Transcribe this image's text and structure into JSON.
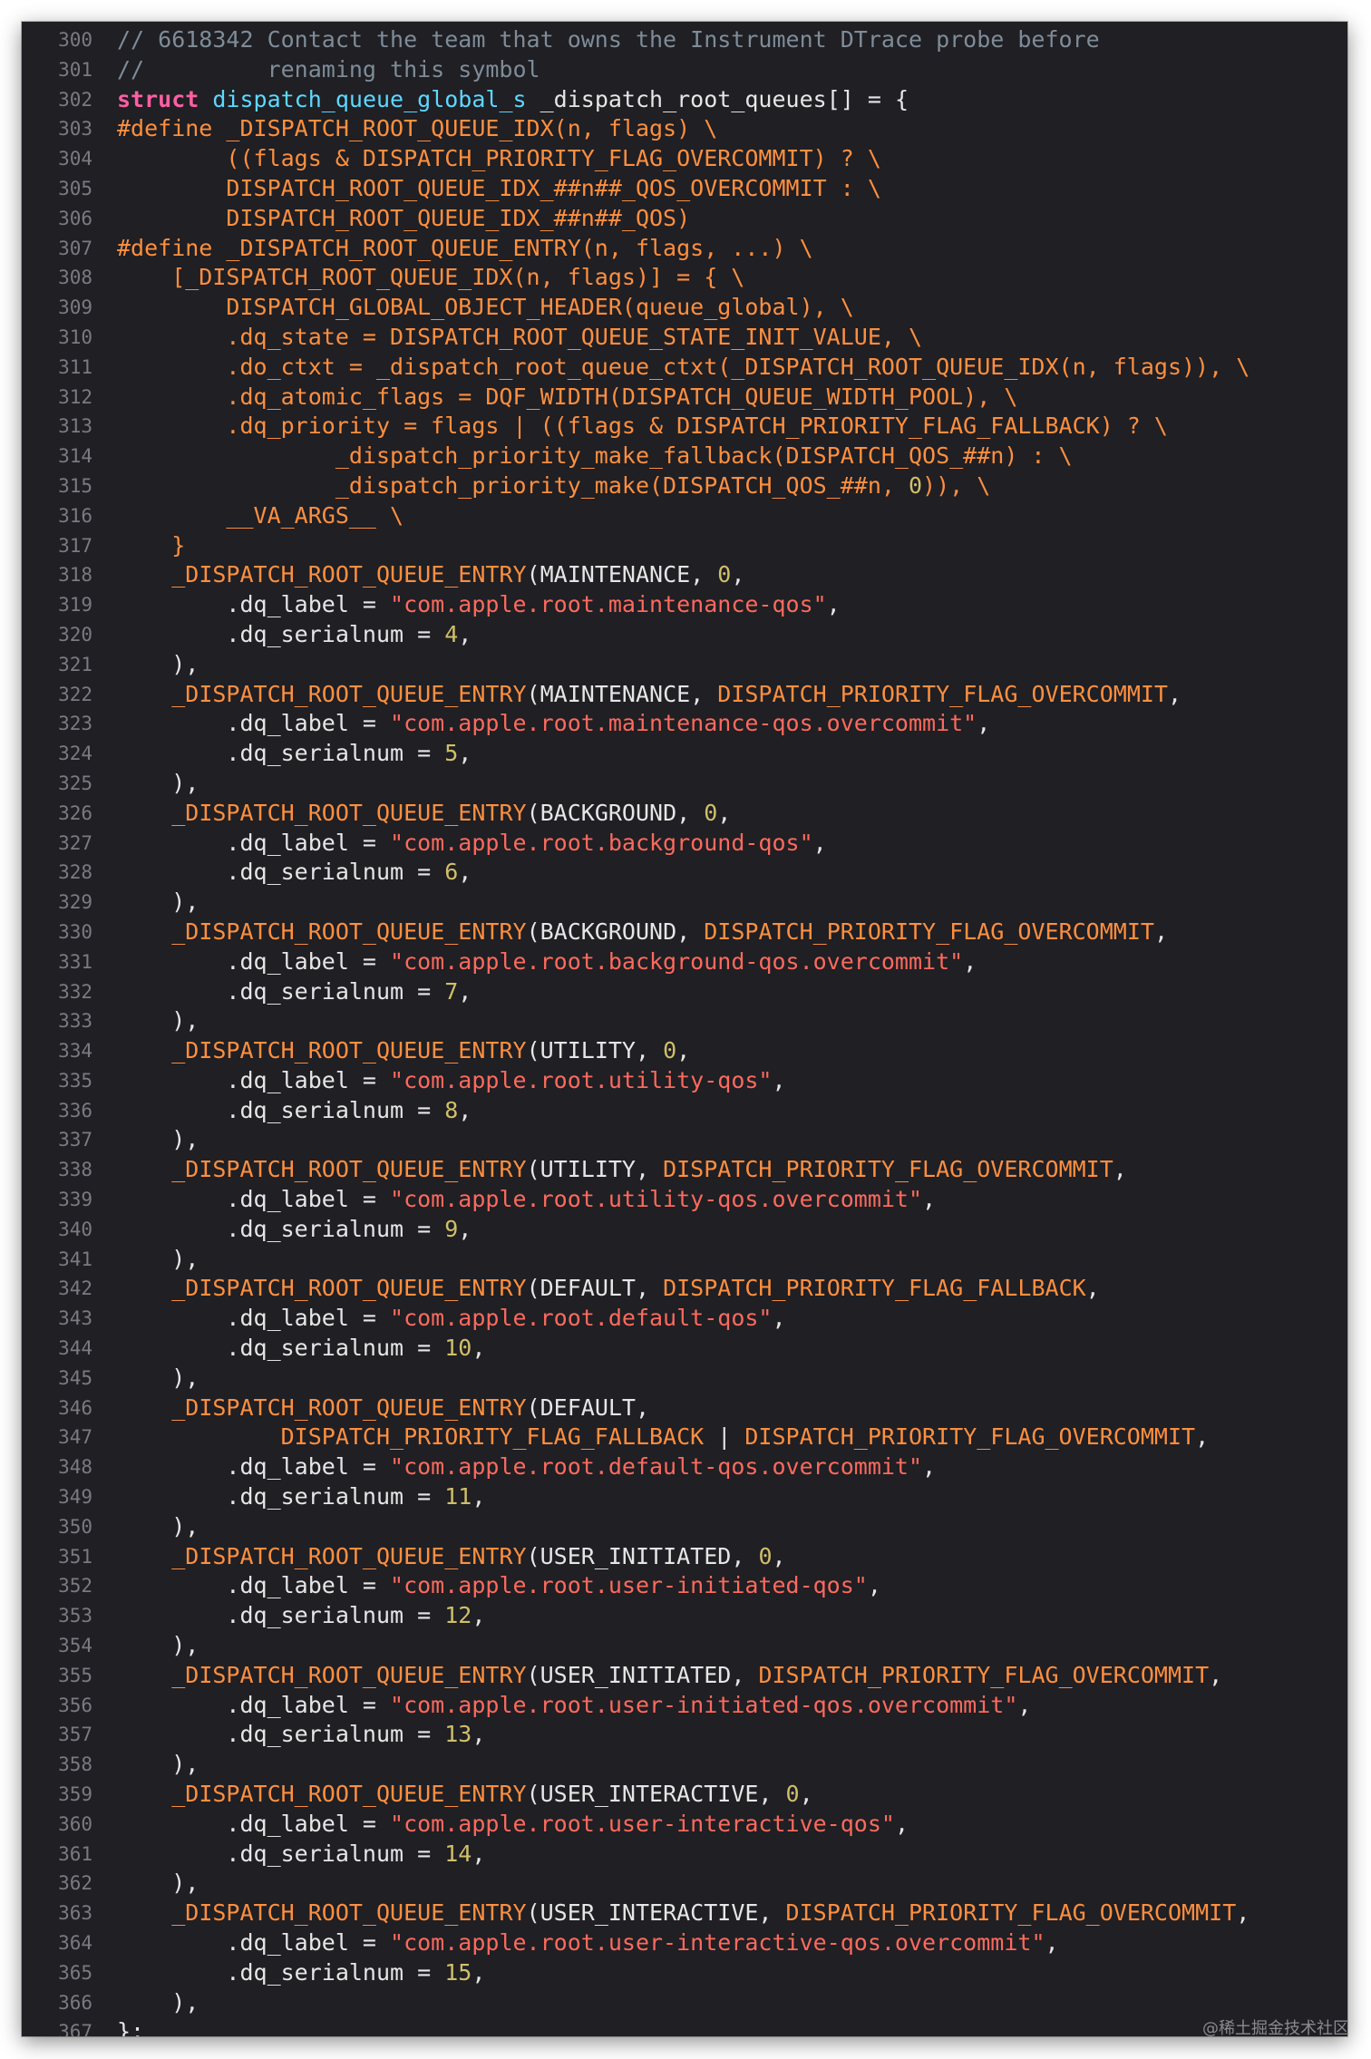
{
  "colors": {
    "background": "#1f1f24",
    "line_number": "#7a7a80",
    "plain": "#e6e6e6",
    "comment": "#7f8c98",
    "keyword": "#fc5fa3",
    "type": "#5dd8ff",
    "macro": "#fd8f3f",
    "string": "#fc6a5d",
    "number": "#d0bf69"
  },
  "editor": {
    "lines": [
      {
        "n": "300",
        "tokens": [
          [
            "comment",
            "// 6618342 Contact the team that owns the Instrument DTrace probe before"
          ]
        ]
      },
      {
        "n": "301",
        "tokens": [
          [
            "comment",
            "//         renaming this symbol"
          ]
        ]
      },
      {
        "n": "302",
        "tokens": [
          [
            "keyword",
            "struct"
          ],
          [
            "plain",
            " "
          ],
          [
            "type",
            "dispatch_queue_global_s"
          ],
          [
            "plain",
            " _dispatch_root_queues[] = {"
          ]
        ]
      },
      {
        "n": "303",
        "tokens": [
          [
            "macro",
            "#define _DISPATCH_ROOT_QUEUE_IDX(n, flags) \\"
          ]
        ]
      },
      {
        "n": "304",
        "tokens": [
          [
            "macro",
            "        ((flags & DISPATCH_PRIORITY_FLAG_OVERCOMMIT) ? \\"
          ]
        ]
      },
      {
        "n": "305",
        "tokens": [
          [
            "macro",
            "        DISPATCH_ROOT_QUEUE_IDX_##n##_QOS_OVERCOMMIT : \\"
          ]
        ]
      },
      {
        "n": "306",
        "tokens": [
          [
            "macro",
            "        DISPATCH_ROOT_QUEUE_IDX_##n##_QOS)"
          ]
        ]
      },
      {
        "n": "307",
        "tokens": [
          [
            "macro",
            "#define _DISPATCH_ROOT_QUEUE_ENTRY(n, flags, ...) \\"
          ]
        ]
      },
      {
        "n": "308",
        "tokens": [
          [
            "macro",
            "    [_DISPATCH_ROOT_QUEUE_IDX(n, flags)] = { \\"
          ]
        ]
      },
      {
        "n": "309",
        "tokens": [
          [
            "macro",
            "        DISPATCH_GLOBAL_OBJECT_HEADER(queue_global), \\"
          ]
        ]
      },
      {
        "n": "310",
        "tokens": [
          [
            "macro",
            "        .dq_state = DISPATCH_ROOT_QUEUE_STATE_INIT_VALUE, \\"
          ]
        ]
      },
      {
        "n": "311",
        "tokens": [
          [
            "macro",
            "        .do_ctxt = _dispatch_root_queue_ctxt(_DISPATCH_ROOT_QUEUE_IDX(n, flags)), \\"
          ]
        ]
      },
      {
        "n": "312",
        "tokens": [
          [
            "macro",
            "        .dq_atomic_flags = DQF_WIDTH(DISPATCH_QUEUE_WIDTH_POOL), \\"
          ]
        ]
      },
      {
        "n": "313",
        "tokens": [
          [
            "macro",
            "        .dq_priority = flags | ((flags & DISPATCH_PRIORITY_FLAG_FALLBACK) ? \\"
          ]
        ]
      },
      {
        "n": "314",
        "tokens": [
          [
            "macro",
            "                _dispatch_priority_make_fallback(DISPATCH_QOS_##n) : \\"
          ]
        ]
      },
      {
        "n": "315",
        "tokens": [
          [
            "macro",
            "                _dispatch_priority_make(DISPATCH_QOS_##n, "
          ],
          [
            "number",
            "0"
          ],
          [
            "macro",
            ")), \\"
          ]
        ]
      },
      {
        "n": "316",
        "tokens": [
          [
            "macro",
            "        __VA_ARGS__ \\"
          ]
        ]
      },
      {
        "n": "317",
        "tokens": [
          [
            "macro",
            "    }"
          ]
        ]
      },
      {
        "n": "318",
        "tokens": [
          [
            "plain",
            "    "
          ],
          [
            "macro",
            "_DISPATCH_ROOT_QUEUE_ENTRY"
          ],
          [
            "plain",
            "(MAINTENANCE, "
          ],
          [
            "number",
            "0"
          ],
          [
            "plain",
            ","
          ]
        ]
      },
      {
        "n": "319",
        "tokens": [
          [
            "plain",
            "        .dq_label = "
          ],
          [
            "string",
            "\"com.apple.root.maintenance-qos\""
          ],
          [
            "plain",
            ","
          ]
        ]
      },
      {
        "n": "320",
        "tokens": [
          [
            "plain",
            "        .dq_serialnum = "
          ],
          [
            "number",
            "4"
          ],
          [
            "plain",
            ","
          ]
        ]
      },
      {
        "n": "321",
        "tokens": [
          [
            "plain",
            "    ),"
          ]
        ]
      },
      {
        "n": "322",
        "tokens": [
          [
            "plain",
            "    "
          ],
          [
            "macro",
            "_DISPATCH_ROOT_QUEUE_ENTRY"
          ],
          [
            "plain",
            "(MAINTENANCE, "
          ],
          [
            "macro",
            "DISPATCH_PRIORITY_FLAG_OVERCOMMIT"
          ],
          [
            "plain",
            ","
          ]
        ]
      },
      {
        "n": "323",
        "tokens": [
          [
            "plain",
            "        .dq_label = "
          ],
          [
            "string",
            "\"com.apple.root.maintenance-qos.overcommit\""
          ],
          [
            "plain",
            ","
          ]
        ]
      },
      {
        "n": "324",
        "tokens": [
          [
            "plain",
            "        .dq_serialnum = "
          ],
          [
            "number",
            "5"
          ],
          [
            "plain",
            ","
          ]
        ]
      },
      {
        "n": "325",
        "tokens": [
          [
            "plain",
            "    ),"
          ]
        ]
      },
      {
        "n": "326",
        "tokens": [
          [
            "plain",
            "    "
          ],
          [
            "macro",
            "_DISPATCH_ROOT_QUEUE_ENTRY"
          ],
          [
            "plain",
            "(BACKGROUND, "
          ],
          [
            "number",
            "0"
          ],
          [
            "plain",
            ","
          ]
        ]
      },
      {
        "n": "327",
        "tokens": [
          [
            "plain",
            "        .dq_label = "
          ],
          [
            "string",
            "\"com.apple.root.background-qos\""
          ],
          [
            "plain",
            ","
          ]
        ]
      },
      {
        "n": "328",
        "tokens": [
          [
            "plain",
            "        .dq_serialnum = "
          ],
          [
            "number",
            "6"
          ],
          [
            "plain",
            ","
          ]
        ]
      },
      {
        "n": "329",
        "tokens": [
          [
            "plain",
            "    ),"
          ]
        ]
      },
      {
        "n": "330",
        "tokens": [
          [
            "plain",
            "    "
          ],
          [
            "macro",
            "_DISPATCH_ROOT_QUEUE_ENTRY"
          ],
          [
            "plain",
            "(BACKGROUND, "
          ],
          [
            "macro",
            "DISPATCH_PRIORITY_FLAG_OVERCOMMIT"
          ],
          [
            "plain",
            ","
          ]
        ]
      },
      {
        "n": "331",
        "tokens": [
          [
            "plain",
            "        .dq_label = "
          ],
          [
            "string",
            "\"com.apple.root.background-qos.overcommit\""
          ],
          [
            "plain",
            ","
          ]
        ]
      },
      {
        "n": "332",
        "tokens": [
          [
            "plain",
            "        .dq_serialnum = "
          ],
          [
            "number",
            "7"
          ],
          [
            "plain",
            ","
          ]
        ]
      },
      {
        "n": "333",
        "tokens": [
          [
            "plain",
            "    ),"
          ]
        ]
      },
      {
        "n": "334",
        "tokens": [
          [
            "plain",
            "    "
          ],
          [
            "macro",
            "_DISPATCH_ROOT_QUEUE_ENTRY"
          ],
          [
            "plain",
            "(UTILITY, "
          ],
          [
            "number",
            "0"
          ],
          [
            "plain",
            ","
          ]
        ]
      },
      {
        "n": "335",
        "tokens": [
          [
            "plain",
            "        .dq_label = "
          ],
          [
            "string",
            "\"com.apple.root.utility-qos\""
          ],
          [
            "plain",
            ","
          ]
        ]
      },
      {
        "n": "336",
        "tokens": [
          [
            "plain",
            "        .dq_serialnum = "
          ],
          [
            "number",
            "8"
          ],
          [
            "plain",
            ","
          ]
        ]
      },
      {
        "n": "337",
        "tokens": [
          [
            "plain",
            "    ),"
          ]
        ]
      },
      {
        "n": "338",
        "tokens": [
          [
            "plain",
            "    "
          ],
          [
            "macro",
            "_DISPATCH_ROOT_QUEUE_ENTRY"
          ],
          [
            "plain",
            "(UTILITY, "
          ],
          [
            "macro",
            "DISPATCH_PRIORITY_FLAG_OVERCOMMIT"
          ],
          [
            "plain",
            ","
          ]
        ]
      },
      {
        "n": "339",
        "tokens": [
          [
            "plain",
            "        .dq_label = "
          ],
          [
            "string",
            "\"com.apple.root.utility-qos.overcommit\""
          ],
          [
            "plain",
            ","
          ]
        ]
      },
      {
        "n": "340",
        "tokens": [
          [
            "plain",
            "        .dq_serialnum = "
          ],
          [
            "number",
            "9"
          ],
          [
            "plain",
            ","
          ]
        ]
      },
      {
        "n": "341",
        "tokens": [
          [
            "plain",
            "    ),"
          ]
        ]
      },
      {
        "n": "342",
        "tokens": [
          [
            "plain",
            "    "
          ],
          [
            "macro",
            "_DISPATCH_ROOT_QUEUE_ENTRY"
          ],
          [
            "plain",
            "(DEFAULT, "
          ],
          [
            "macro",
            "DISPATCH_PRIORITY_FLAG_FALLBACK"
          ],
          [
            "plain",
            ","
          ]
        ]
      },
      {
        "n": "343",
        "tokens": [
          [
            "plain",
            "        .dq_label = "
          ],
          [
            "string",
            "\"com.apple.root.default-qos\""
          ],
          [
            "plain",
            ","
          ]
        ]
      },
      {
        "n": "344",
        "tokens": [
          [
            "plain",
            "        .dq_serialnum = "
          ],
          [
            "number",
            "10"
          ],
          [
            "plain",
            ","
          ]
        ]
      },
      {
        "n": "345",
        "tokens": [
          [
            "plain",
            "    ),"
          ]
        ]
      },
      {
        "n": "346",
        "tokens": [
          [
            "plain",
            "    "
          ],
          [
            "macro",
            "_DISPATCH_ROOT_QUEUE_ENTRY"
          ],
          [
            "plain",
            "(DEFAULT,"
          ]
        ]
      },
      {
        "n": "347",
        "tokens": [
          [
            "plain",
            "            "
          ],
          [
            "macro",
            "DISPATCH_PRIORITY_FLAG_FALLBACK"
          ],
          [
            "plain",
            " | "
          ],
          [
            "macro",
            "DISPATCH_PRIORITY_FLAG_OVERCOMMIT"
          ],
          [
            "plain",
            ","
          ]
        ]
      },
      {
        "n": "348",
        "tokens": [
          [
            "plain",
            "        .dq_label = "
          ],
          [
            "string",
            "\"com.apple.root.default-qos.overcommit\""
          ],
          [
            "plain",
            ","
          ]
        ]
      },
      {
        "n": "349",
        "tokens": [
          [
            "plain",
            "        .dq_serialnum = "
          ],
          [
            "number",
            "11"
          ],
          [
            "plain",
            ","
          ]
        ]
      },
      {
        "n": "350",
        "tokens": [
          [
            "plain",
            "    ),"
          ]
        ]
      },
      {
        "n": "351",
        "tokens": [
          [
            "plain",
            "    "
          ],
          [
            "macro",
            "_DISPATCH_ROOT_QUEUE_ENTRY"
          ],
          [
            "plain",
            "(USER_INITIATED, "
          ],
          [
            "number",
            "0"
          ],
          [
            "plain",
            ","
          ]
        ]
      },
      {
        "n": "352",
        "tokens": [
          [
            "plain",
            "        .dq_label = "
          ],
          [
            "string",
            "\"com.apple.root.user-initiated-qos\""
          ],
          [
            "plain",
            ","
          ]
        ]
      },
      {
        "n": "353",
        "tokens": [
          [
            "plain",
            "        .dq_serialnum = "
          ],
          [
            "number",
            "12"
          ],
          [
            "plain",
            ","
          ]
        ]
      },
      {
        "n": "354",
        "tokens": [
          [
            "plain",
            "    ),"
          ]
        ]
      },
      {
        "n": "355",
        "tokens": [
          [
            "plain",
            "    "
          ],
          [
            "macro",
            "_DISPATCH_ROOT_QUEUE_ENTRY"
          ],
          [
            "plain",
            "(USER_INITIATED, "
          ],
          [
            "macro",
            "DISPATCH_PRIORITY_FLAG_OVERCOMMIT"
          ],
          [
            "plain",
            ","
          ]
        ]
      },
      {
        "n": "356",
        "tokens": [
          [
            "plain",
            "        .dq_label = "
          ],
          [
            "string",
            "\"com.apple.root.user-initiated-qos.overcommit\""
          ],
          [
            "plain",
            ","
          ]
        ]
      },
      {
        "n": "357",
        "tokens": [
          [
            "plain",
            "        .dq_serialnum = "
          ],
          [
            "number",
            "13"
          ],
          [
            "plain",
            ","
          ]
        ]
      },
      {
        "n": "358",
        "tokens": [
          [
            "plain",
            "    ),"
          ]
        ]
      },
      {
        "n": "359",
        "tokens": [
          [
            "plain",
            "    "
          ],
          [
            "macro",
            "_DISPATCH_ROOT_QUEUE_ENTRY"
          ],
          [
            "plain",
            "(USER_INTERACTIVE, "
          ],
          [
            "number",
            "0"
          ],
          [
            "plain",
            ","
          ]
        ]
      },
      {
        "n": "360",
        "tokens": [
          [
            "plain",
            "        .dq_label = "
          ],
          [
            "string",
            "\"com.apple.root.user-interactive-qos\""
          ],
          [
            "plain",
            ","
          ]
        ]
      },
      {
        "n": "361",
        "tokens": [
          [
            "plain",
            "        .dq_serialnum = "
          ],
          [
            "number",
            "14"
          ],
          [
            "plain",
            ","
          ]
        ]
      },
      {
        "n": "362",
        "tokens": [
          [
            "plain",
            "    ),"
          ]
        ]
      },
      {
        "n": "363",
        "tokens": [
          [
            "plain",
            "    "
          ],
          [
            "macro",
            "_DISPATCH_ROOT_QUEUE_ENTRY"
          ],
          [
            "plain",
            "(USER_INTERACTIVE, "
          ],
          [
            "macro",
            "DISPATCH_PRIORITY_FLAG_OVERCOMMIT"
          ],
          [
            "plain",
            ","
          ]
        ]
      },
      {
        "n": "364",
        "tokens": [
          [
            "plain",
            "        .dq_label = "
          ],
          [
            "string",
            "\"com.apple.root.user-interactive-qos.overcommit\""
          ],
          [
            "plain",
            ","
          ]
        ]
      },
      {
        "n": "365",
        "tokens": [
          [
            "plain",
            "        .dq_serialnum = "
          ],
          [
            "number",
            "15"
          ],
          [
            "plain",
            ","
          ]
        ]
      },
      {
        "n": "366",
        "tokens": [
          [
            "plain",
            "    ),"
          ]
        ]
      },
      {
        "n": "367",
        "tokens": [
          [
            "plain",
            "};"
          ]
        ]
      }
    ]
  },
  "watermark": "@稀土掘金技术社区"
}
